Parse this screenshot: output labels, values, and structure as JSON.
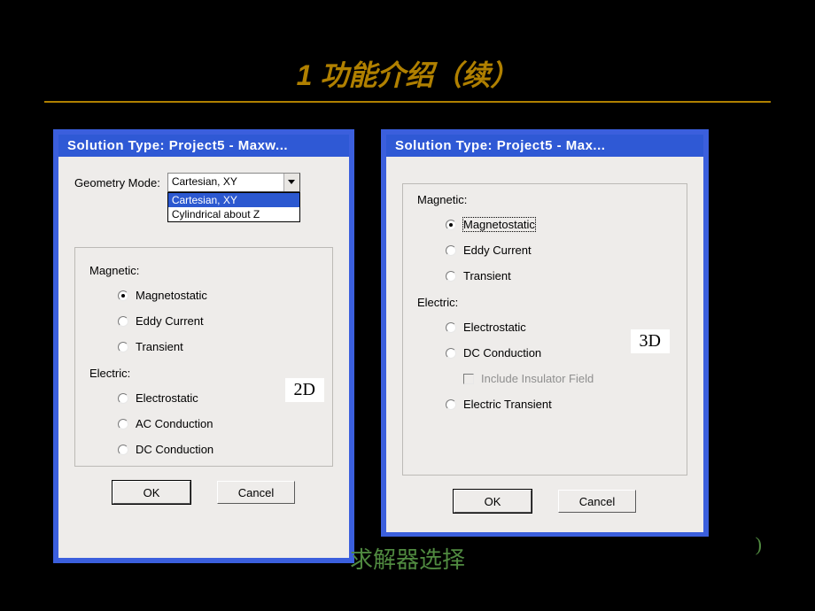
{
  "slide": {
    "title": "1 功能介绍（续）",
    "caption": "求解器选择",
    "trail": ")"
  },
  "dialog2d": {
    "title": "Solution Type: Project5 - Maxw...",
    "geom_label": "Geometry Mode:",
    "combo_value": "Cartesian, XY",
    "dropdown": {
      "opt1": "Cartesian, XY",
      "opt2": "Cylindrical about Z"
    },
    "magnetic_label": "Magnetic:",
    "electric_label": "Electric:",
    "radios": {
      "magnetostatic": "Magnetostatic",
      "eddy": "Eddy Current",
      "transient": "Transient",
      "electrostatic": "Electrostatic",
      "ac_cond": "AC Conduction",
      "dc_cond": "DC Conduction"
    },
    "ok": "OK",
    "cancel": "Cancel",
    "badge": "2D"
  },
  "dialog3d": {
    "title": "Solution Type: Project5 - Max...",
    "magnetic_label": "Magnetic:",
    "electric_label": "Electric:",
    "radios": {
      "magnetostatic": "Magnetostatic",
      "eddy": "Eddy Current",
      "transient": "Transient",
      "electrostatic": "Electrostatic",
      "dc_cond": "DC Conduction",
      "include_ins": "Include Insulator Field",
      "elec_trans": "Electric Transient"
    },
    "ok": "OK",
    "cancel": "Cancel",
    "badge": "3D"
  }
}
